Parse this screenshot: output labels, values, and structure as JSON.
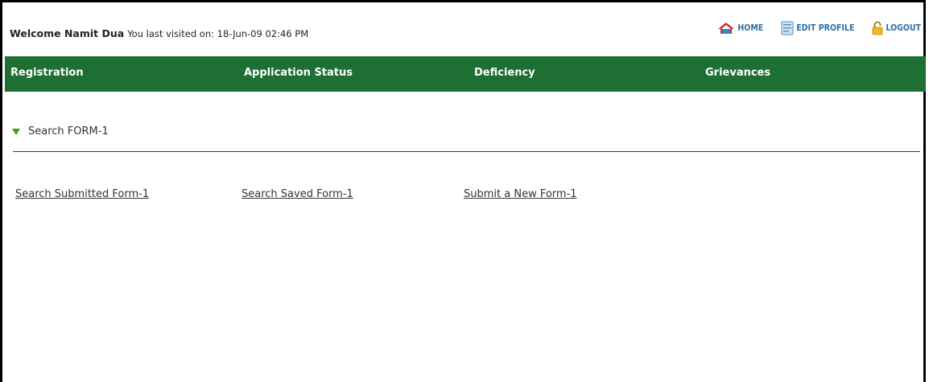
{
  "header": {
    "welcome_prefix": "Welcome Namit Dua",
    "last_visited": "You last visited on: 18-Jun-09 02:46 PM",
    "links": {
      "home": "HOME",
      "edit_profile": "EDIT PROFILE",
      "logout": "LOGOUT"
    },
    "icons": {
      "home": "home-icon",
      "edit_profile": "profile-card-icon",
      "logout": "padlock-icon"
    }
  },
  "nav": {
    "items": [
      {
        "label": "Registration"
      },
      {
        "label": "Application Status"
      },
      {
        "label": "Deficiency"
      },
      {
        "label": "Grievances"
      }
    ]
  },
  "section": {
    "title": "Search FORM-1"
  },
  "actions": [
    {
      "label": "Search Submitted Form-1"
    },
    {
      "label": "Search Saved Form-1"
    },
    {
      "label": "Submit a New Form-1"
    }
  ],
  "colors": {
    "nav_background": "#1d6f33",
    "link_blue": "#2d6fa6",
    "triangle_green": "#4a9a1a"
  }
}
